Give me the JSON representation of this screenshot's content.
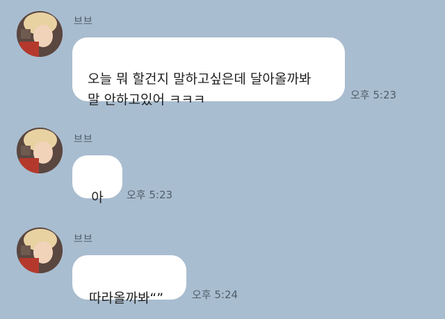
{
  "messages": [
    {
      "sender": "브브",
      "text": "오늘 뭐 할건지 말하고싶은데 달아올까봐\n말 안하고있어 ㅋㅋㅋ",
      "time": "오후 5:23"
    },
    {
      "sender": "브브",
      "text": "아",
      "time": "오후 5:23"
    },
    {
      "sender": "브브",
      "text": "따라올까봐“”",
      "time": "오후 5:24"
    }
  ],
  "colors": {
    "background": "#a9bdd0",
    "bubble": "#ffffff",
    "timestamp": "#4f5d69"
  }
}
